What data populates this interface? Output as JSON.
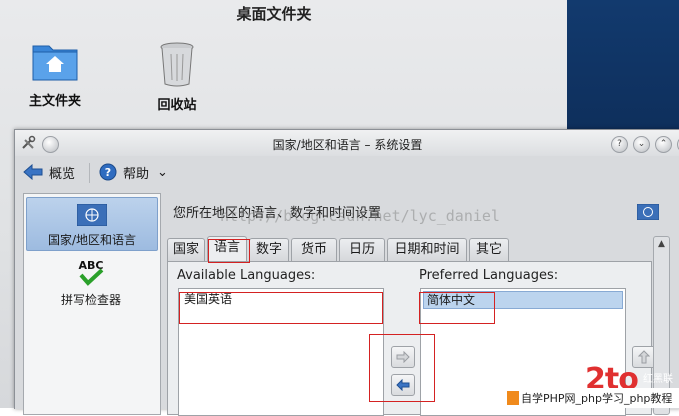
{
  "desktop": {
    "folder_title": "桌面文件夹",
    "icons": [
      {
        "label": "主文件夹",
        "icon": "home-folder-icon"
      },
      {
        "label": "回收站",
        "icon": "trash-icon"
      }
    ]
  },
  "window": {
    "title": "国家/地区和语言 – 系统设置",
    "toolbar": {
      "overview_label": "概览",
      "help_label": "帮助",
      "menu_arrow": "⌄"
    },
    "sidebar": {
      "items": [
        {
          "label": "国家/地区和语言",
          "icon": "un-flag-icon",
          "selected": true
        },
        {
          "label": "拼写检查器",
          "icon": "abc-spellcheck-icon",
          "selected": false
        }
      ]
    },
    "header": {
      "description": "您所在地区的语言、数字和时间设置"
    },
    "tabs": [
      "国家",
      "语言",
      "数字",
      "货币",
      "日历",
      "日期和时间",
      "其它"
    ],
    "active_tab": "语言",
    "languages": {
      "available_label": "Available Languages:",
      "available_items": [
        "美国英语"
      ],
      "preferred_label": "Preferred Languages:",
      "preferred_items": [
        "简体中文"
      ]
    }
  },
  "overlay": {
    "watermark": "http://blog.csdn.net/lyc_daniel",
    "logo_big": "2to",
    "logo_side": "红黑联盟",
    "logo_caption": "自学PHP网_php学习_php教程"
  },
  "colors": {
    "accent": "#3a74c4",
    "annotation_red": "#d42222",
    "selection": "#bcd4ee"
  }
}
